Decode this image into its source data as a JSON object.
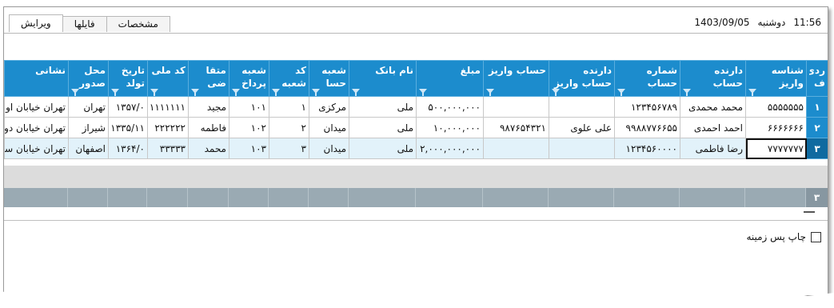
{
  "tabs": [
    {
      "label": "ویرایش",
      "active": true
    },
    {
      "label": "فایلها",
      "active": false
    },
    {
      "label": "مشخصات",
      "active": false
    }
  ],
  "datetime": {
    "time": "11:56",
    "weekday": "دوشنبه",
    "date": "1403/09/05"
  },
  "table": {
    "columns": [
      {
        "label": "ردی ف",
        "filter": false
      },
      {
        "label": "شناسه واریز",
        "filter": true
      },
      {
        "label": "دارنده حساب",
        "filter": true
      },
      {
        "label": "شماره حساب",
        "filter": true
      },
      {
        "label": "دارنده حساب واریز",
        "filter": true
      },
      {
        "label": "حساب واریز",
        "filter": true
      },
      {
        "label": "مبلغ",
        "filter": true
      },
      {
        "label": "نام بانک",
        "filter": true
      },
      {
        "label": "شعبه حسا",
        "filter": true
      },
      {
        "label": "کد شعبه",
        "filter": true
      },
      {
        "label": "شعبه پرداخ",
        "filter": true
      },
      {
        "label": "متقا ضی",
        "filter": true
      },
      {
        "label": "کد ملی",
        "filter": true
      },
      {
        "label": "تاریخ تولد",
        "filter": true
      },
      {
        "label": "محل صدور",
        "filter": true
      },
      {
        "label": "نشانی",
        "filter": false
      }
    ],
    "rows": [
      [
        "۱",
        "۵۵۵۵۵۵۵",
        "محمد محمدی",
        "۱۲۳۴۵۶۷۸۹",
        "",
        "",
        "۵۰۰,۰۰۰,۰۰۰",
        "ملی",
        "مرکزی",
        "۱",
        "۱۰۱",
        "مجید",
        "۱۱۱۱۱۱۱۱۱۱",
        "۱۳۵۷/۰",
        "تهران",
        "تهران خیابان اول"
      ],
      [
        "۲",
        "۶۶۶۶۶۶۶",
        "احمد احمدی",
        "۹۹۸۸۷۷۶۶۵۵",
        "علی علوی",
        "۹۸۷۶۵۴۳۲۱",
        "۱۰,۰۰۰,۰۰۰",
        "ملی",
        "میدان",
        "۲",
        "۱۰۲",
        "فاطمه",
        "۲۲۲۲۲۲",
        "۱۳۳۵/۱۱",
        "شیراز",
        "تهران خیابان دوه"
      ],
      [
        "۳",
        "۷۷۷۷۷۷۷",
        "رضا فاطمی",
        "۱۲۳۴۵۶۰۰۰۰",
        "",
        "",
        "۲,۰۰۰,۰۰۰,۰۰۰",
        "ملی",
        "میدان",
        "۳",
        "۱۰۳",
        "محمد",
        "۳۳۳۳۳",
        "۱۳۶۴/۰",
        "اصفهان",
        "تهران خیابان سو"
      ]
    ],
    "footer_count": "۳"
  },
  "panel": {
    "print_background_label": "چاپ پس زمینه",
    "print_background_checked": false
  },
  "colors": {
    "header_blue": "#1c8ccd",
    "selected_row": "#e2f2fa",
    "footer_gray": "#9aaab3"
  }
}
